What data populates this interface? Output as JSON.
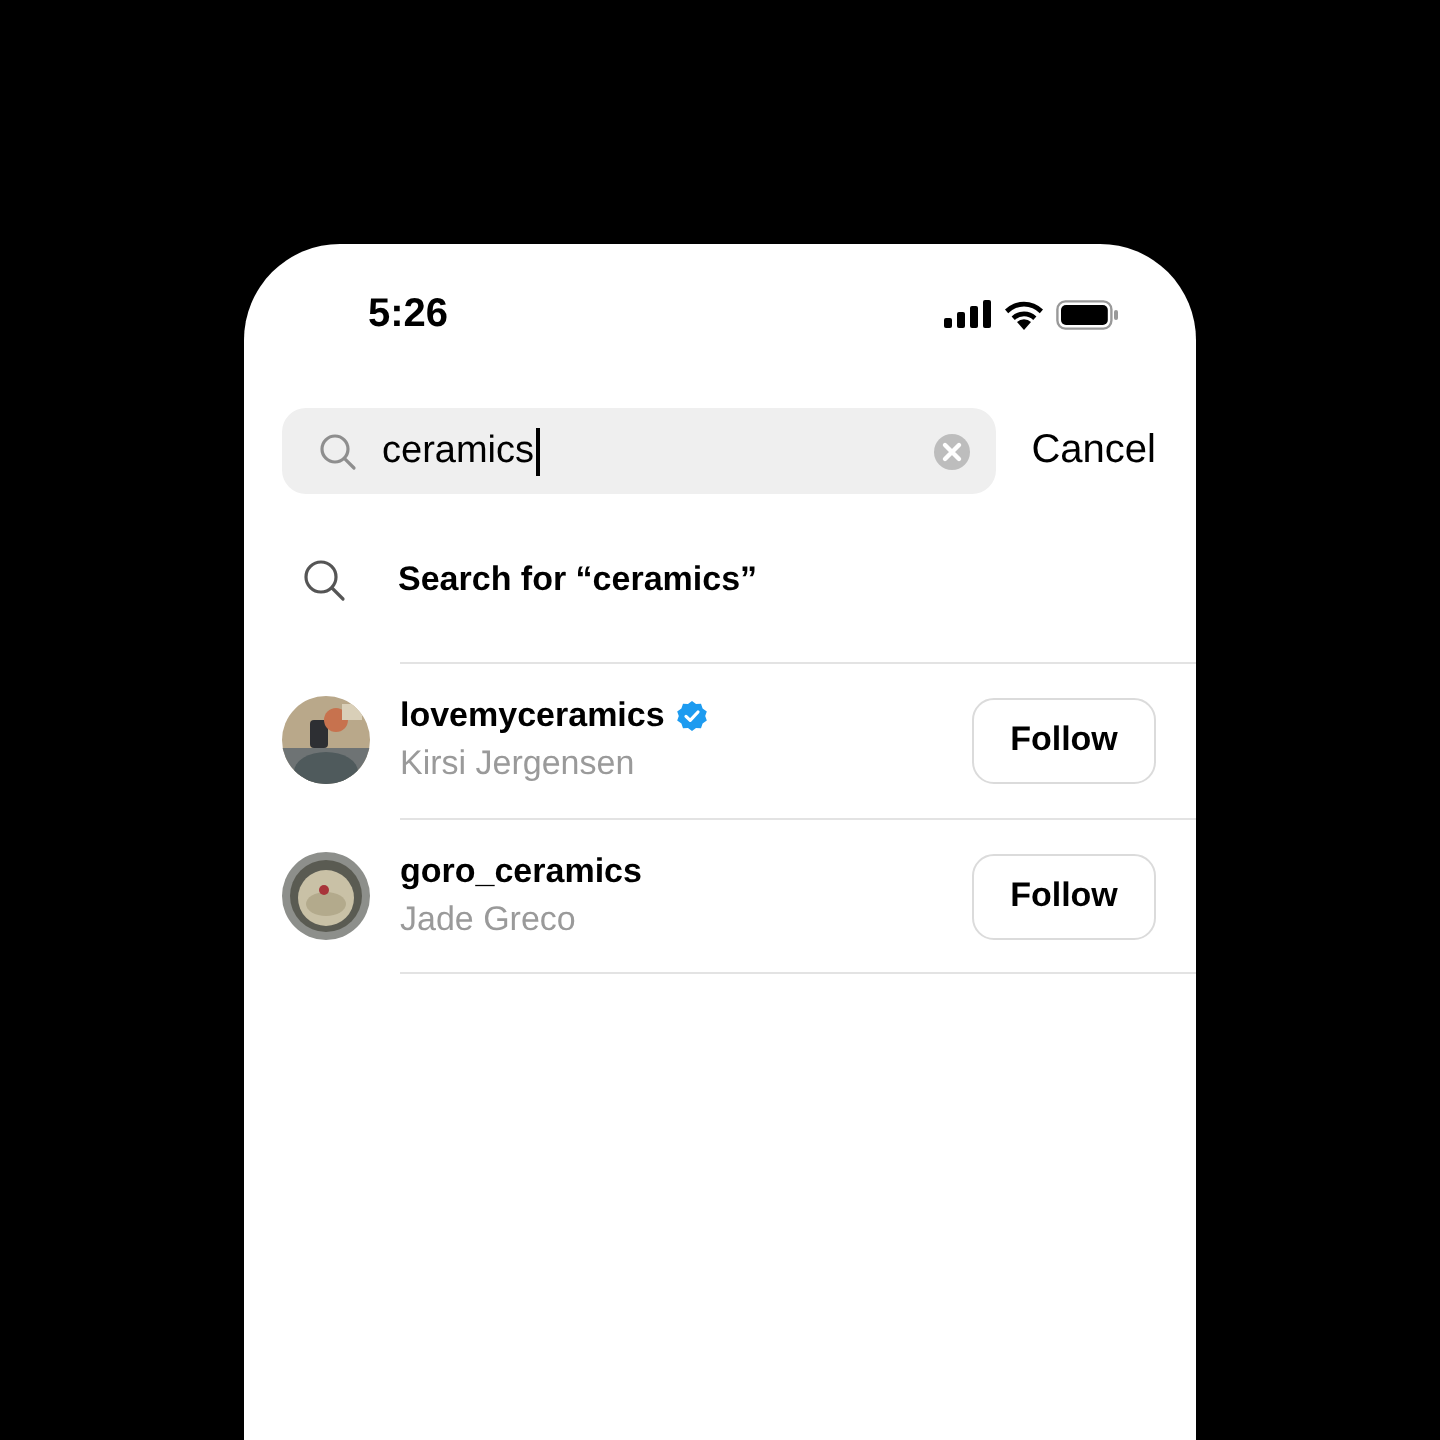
{
  "status_bar": {
    "time": "5:26"
  },
  "search": {
    "value": "ceramics",
    "cancel": "Cancel"
  },
  "suggestion": {
    "label": "Search for “ceramics”"
  },
  "results": [
    {
      "username": "lovemyceramics",
      "verified": true,
      "name": "Kirsi Jergensen",
      "button": "Follow"
    },
    {
      "username": "goro_ceramics",
      "verified": false,
      "name": "Jade Greco",
      "button": "Follow"
    }
  ]
}
